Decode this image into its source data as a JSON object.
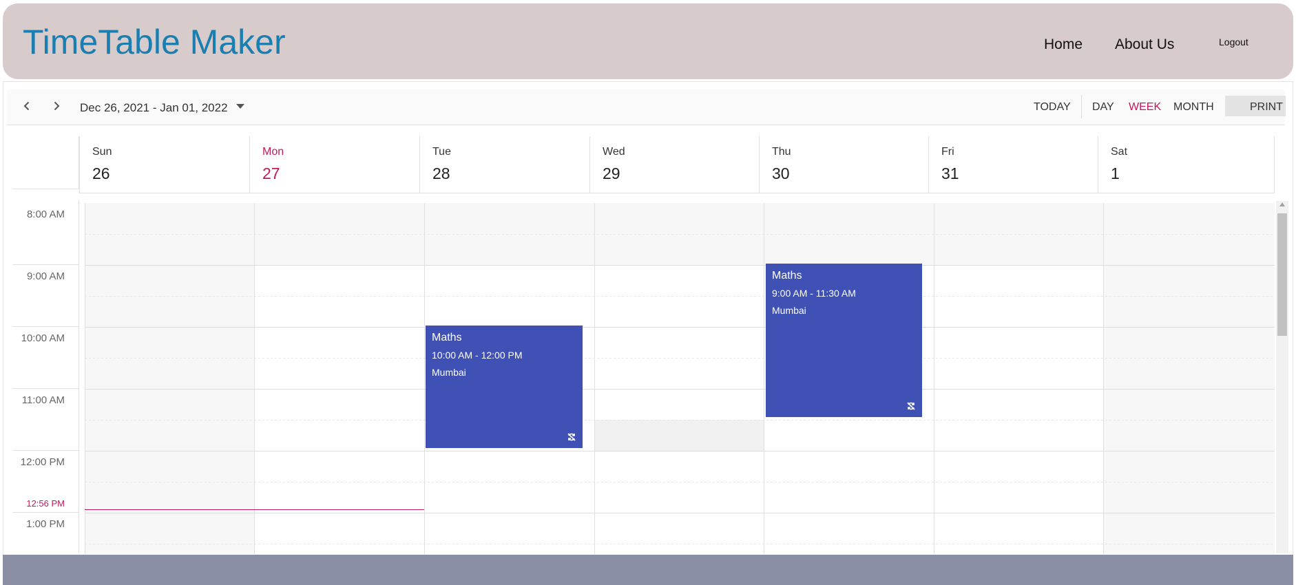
{
  "header": {
    "brand": "TimeTable Maker",
    "nav": {
      "home": "Home",
      "about": "About Us",
      "logout": "Logout"
    }
  },
  "toolbar": {
    "date_range": "Dec 26, 2021 - Jan 01, 2022",
    "today": "TODAY",
    "views": {
      "day": "DAY",
      "week": "WEEK",
      "month": "MONTH"
    },
    "active_view": "week",
    "print": "PRINT",
    "icons": {
      "prev": "chevron-left-icon",
      "next": "chevron-right-icon",
      "picker": "caret-down-icon"
    }
  },
  "days": [
    {
      "name": "Sun",
      "num": "26"
    },
    {
      "name": "Mon",
      "num": "27"
    },
    {
      "name": "Tue",
      "num": "28"
    },
    {
      "name": "Wed",
      "num": "29"
    },
    {
      "name": "Thu",
      "num": "30"
    },
    {
      "name": "Fri",
      "num": "31"
    },
    {
      "name": "Sat",
      "num": "1"
    }
  ],
  "today_index": 1,
  "times": [
    "8:00 AM",
    "9:00 AM",
    "10:00 AM",
    "11:00 AM",
    "12:00 PM",
    "1:00 PM"
  ],
  "current_time": "12:56 PM",
  "events": [
    {
      "title": "Maths",
      "time": "10:00 AM - 12:00 PM",
      "location": "Mumbai",
      "day": "Tue",
      "icon": "recurrence-off-icon"
    },
    {
      "title": "Maths",
      "time": "9:00 AM - 11:30 AM",
      "location": "Mumbai",
      "day": "Thu",
      "icon": "recurrence-off-icon"
    }
  ],
  "colors": {
    "brand": "#1a7fb0",
    "today": "#c2185b",
    "event": "#3f51b5",
    "header_bg": "#d7cbcb",
    "footer_bg": "#8a8fa6"
  }
}
